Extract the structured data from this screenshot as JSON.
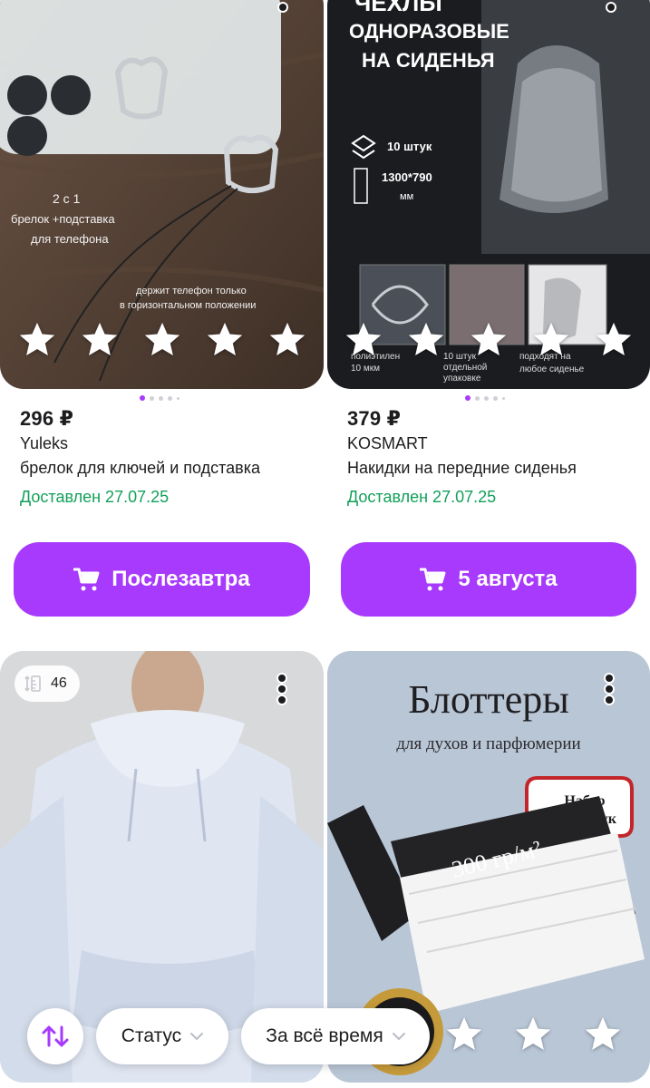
{
  "products": [
    {
      "price": "296 ₽",
      "brand": "Yuleks",
      "title": "брелок для ключей и подставка",
      "status": "Доставлен 27.07.25",
      "button_label": "Послезавтра",
      "image_text": {
        "line1": "2 с 1",
        "line2": "брелок +подставка",
        "line3": "для телефона",
        "line4": "держит телефон только",
        "line5": "в горизонтальном положении"
      }
    },
    {
      "price": "379 ₽",
      "brand": "KOSMART",
      "title": "Накидки на передние сиденья",
      "status": "Доставлен 27.07.25",
      "button_label": "5 августа",
      "image_text": {
        "head1": "ЧЕХЛЫ",
        "head2": "ОДНОРАЗОВЫЕ",
        "head3": "НА СИДЕНЬЯ",
        "count": "10 штук",
        "size": "1300*790",
        "unit": "мм",
        "cap1a": "полиэтилен",
        "cap1b": "10 мкм",
        "cap2a": "10 штук",
        "cap2b": "отдельной",
        "cap2c": "упаковке",
        "cap3a": "подходят на",
        "cap3b": "любое сиденье"
      }
    },
    {
      "badge_count": "46"
    },
    {
      "image_text": {
        "headline": "Блоттеры",
        "subline": "для духов и парфюмерии",
        "bubble1": "Набор",
        "bubble2": "из 3 штук",
        "density": "300 гр/м²"
      }
    }
  ],
  "filters": {
    "status_label": "Статус",
    "period_label": "За всё время"
  },
  "colors": {
    "accent": "#a73afd",
    "delivered": "#13a05a"
  },
  "icons": [
    "star-icon",
    "cart-icon",
    "more-vertical-icon",
    "size-ruler-icon",
    "sort-icon",
    "chevron-down-icon"
  ]
}
